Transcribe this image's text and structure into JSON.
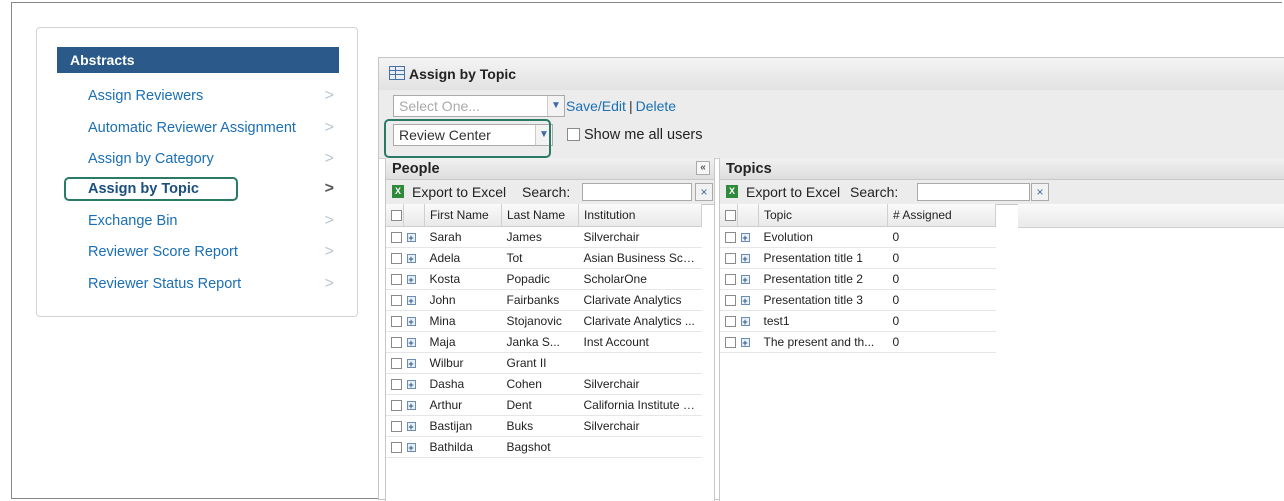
{
  "nav": {
    "header": "Abstracts",
    "items": [
      {
        "label": "Assign Reviewers",
        "active": false
      },
      {
        "label": "Automatic Reviewer Assignment",
        "active": false
      },
      {
        "label": "Assign by Category",
        "active": false
      },
      {
        "label": "Assign by Topic",
        "active": true
      },
      {
        "label": "Exchange Bin",
        "active": false
      },
      {
        "label": "Reviewer Score Report",
        "active": false
      },
      {
        "label": "Reviewer Status Report",
        "active": false
      }
    ],
    "chevron": ">"
  },
  "panel": {
    "title": "Assign by Topic",
    "saved_view_select": {
      "placeholder": "Select One...",
      "value": ""
    },
    "save_edit_label": "Save/Edit",
    "separator": "|",
    "delete_label": "Delete",
    "user_scope_select": {
      "value": "Review Center"
    },
    "show_all_users_label": "Show me all users"
  },
  "people": {
    "title": "People",
    "collapse_glyph": "«",
    "export_label": "Export to Excel",
    "search_label": "Search:",
    "search_value": "",
    "clear_glyph": "×",
    "columns": [
      "First Name",
      "Last Name",
      "Institution"
    ],
    "rows": [
      [
        "Sarah",
        "James",
        "Silverchair"
      ],
      [
        "Adela",
        "Tot",
        "Asian Business Sch..."
      ],
      [
        "Kosta",
        "Popadic",
        "ScholarOne"
      ],
      [
        "John",
        "Fairbanks",
        "Clarivate Analytics"
      ],
      [
        "Mina",
        "Stojanovic",
        "Clarivate Analytics ..."
      ],
      [
        "Maja",
        "Janka S...",
        "Inst Account"
      ],
      [
        "Wilbur",
        "Grant II",
        ""
      ],
      [
        "Dasha",
        "Cohen",
        "Silverchair"
      ],
      [
        "Arthur",
        "Dent",
        "California Institute o..."
      ],
      [
        "Bastijan",
        "Buks",
        "Silverchair"
      ],
      [
        "Bathilda",
        "Bagshot",
        ""
      ]
    ]
  },
  "topics": {
    "title": "Topics",
    "export_label": "Export to Excel",
    "search_label": "Search:",
    "search_value": "",
    "clear_glyph": "×",
    "columns": [
      "Topic",
      "# Assigned"
    ],
    "rows": [
      [
        "Evolution",
        "0"
      ],
      [
        "Presentation title 1",
        "0"
      ],
      [
        "Presentation title 2",
        "0"
      ],
      [
        "Presentation title 3",
        "0"
      ],
      [
        "test1",
        "0"
      ],
      [
        "The present and th...",
        "0"
      ]
    ]
  },
  "icons": {
    "table": "table-icon",
    "excel": "excel-icon",
    "expand": "expand-row-icon",
    "dropdown": "dropdown-arrow-icon"
  },
  "colors": {
    "nav_header_bg": "#2b5a8a",
    "link": "#1a6fb5",
    "highlight_outline": "#2a7a66"
  }
}
